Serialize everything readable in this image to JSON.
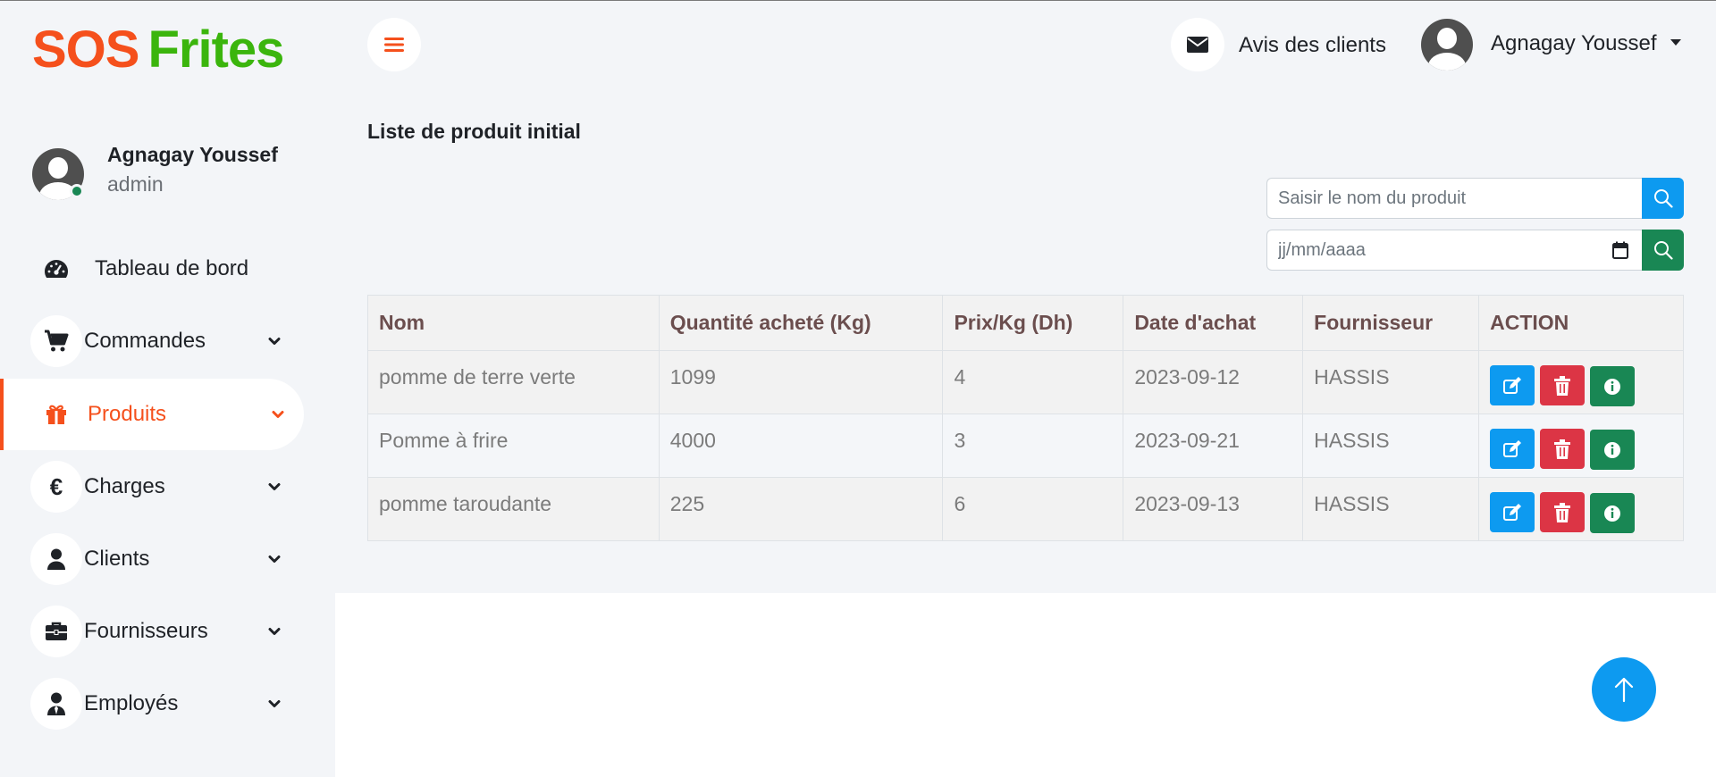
{
  "brand": {
    "part1": "SOS",
    "part2": "Frites"
  },
  "profile": {
    "name": "Agnagay Youssef",
    "role": "admin"
  },
  "sidebar": {
    "items": [
      {
        "label": "Tableau de bord"
      },
      {
        "label": "Commandes"
      },
      {
        "label": "Produits"
      },
      {
        "label": "Charges"
      },
      {
        "label": "Clients"
      },
      {
        "label": "Fournisseurs"
      },
      {
        "label": "Employés"
      }
    ],
    "active": "Produits"
  },
  "topbar": {
    "reviews_label": "Avis des clients",
    "user_name": "Agnagay Youssef"
  },
  "main": {
    "title": "Liste de produit initial",
    "search": {
      "placeholder": "Saisir le nom du produit"
    },
    "date_filter": {
      "placeholder": "jj/mm/aaaa"
    }
  },
  "table": {
    "headers": [
      "Nom",
      "Quantité acheté (Kg)",
      "Prix/Kg (Dh)",
      "Date d'achat",
      "Fournisseur",
      "ACTION"
    ],
    "rows": [
      [
        "pomme de terre verte",
        "1099",
        "4",
        "2023-09-12",
        "HASSIS"
      ],
      [
        "Pomme à frire",
        "4000",
        "3",
        "2023-09-21",
        "HASSIS"
      ],
      [
        "pomme taroudante",
        "225",
        "6",
        "2023-09-13",
        "HASSIS"
      ]
    ]
  },
  "colors": {
    "brand_orange": "#f5501c",
    "brand_green": "#3bb50d",
    "edit_blue": "#0d9af0",
    "delete_red": "#dc3545",
    "info_green": "#198754"
  },
  "icons": {
    "menu": "hamburger-icon",
    "reviews": "envelope-icon",
    "user_caret": "caret-down-icon",
    "search": "search-icon",
    "calendar": "calendar-icon",
    "edit": "edit-icon",
    "delete": "trash-icon",
    "info": "info-icon",
    "scroll_top": "arrow-up-icon"
  }
}
